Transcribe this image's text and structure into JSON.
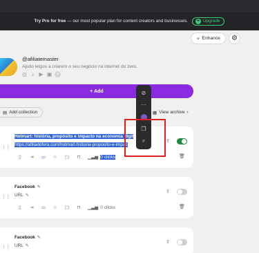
{
  "promo": {
    "lead": "Try Pro for free",
    "text": " — our most popular plan for content creators and businesses.",
    "upgrade_label": "Upgrade"
  },
  "header": {
    "enhance_label": "Enhance"
  },
  "profile": {
    "username": "@afiliatemaster",
    "bio": "Ajudo leigos a criarem o seu negócio na internet do zero."
  },
  "actions": {
    "add_label": "+ Add",
    "add_collection_label": "Add collection",
    "view_archive_label": "View archive"
  },
  "links": [
    {
      "title": "Hotmart: história, propósito e impacto na economia digit",
      "url": "https://afiliadofera.com/hotmart-historia-proposito-e-impac",
      "clicks": "0 clicks",
      "enabled": true
    },
    {
      "title": "Facebook",
      "url": "URL",
      "clicks": "0 clicks",
      "enabled": false
    },
    {
      "title": "Facebook",
      "url": "URL",
      "enabled": false
    }
  ],
  "colors": {
    "accent": "#8a2be2",
    "toggle_on": "#1f8a3a",
    "toggle_off": "#cfcfcf",
    "highlight": "#e02020",
    "upgrade": "#3ccf7a"
  }
}
